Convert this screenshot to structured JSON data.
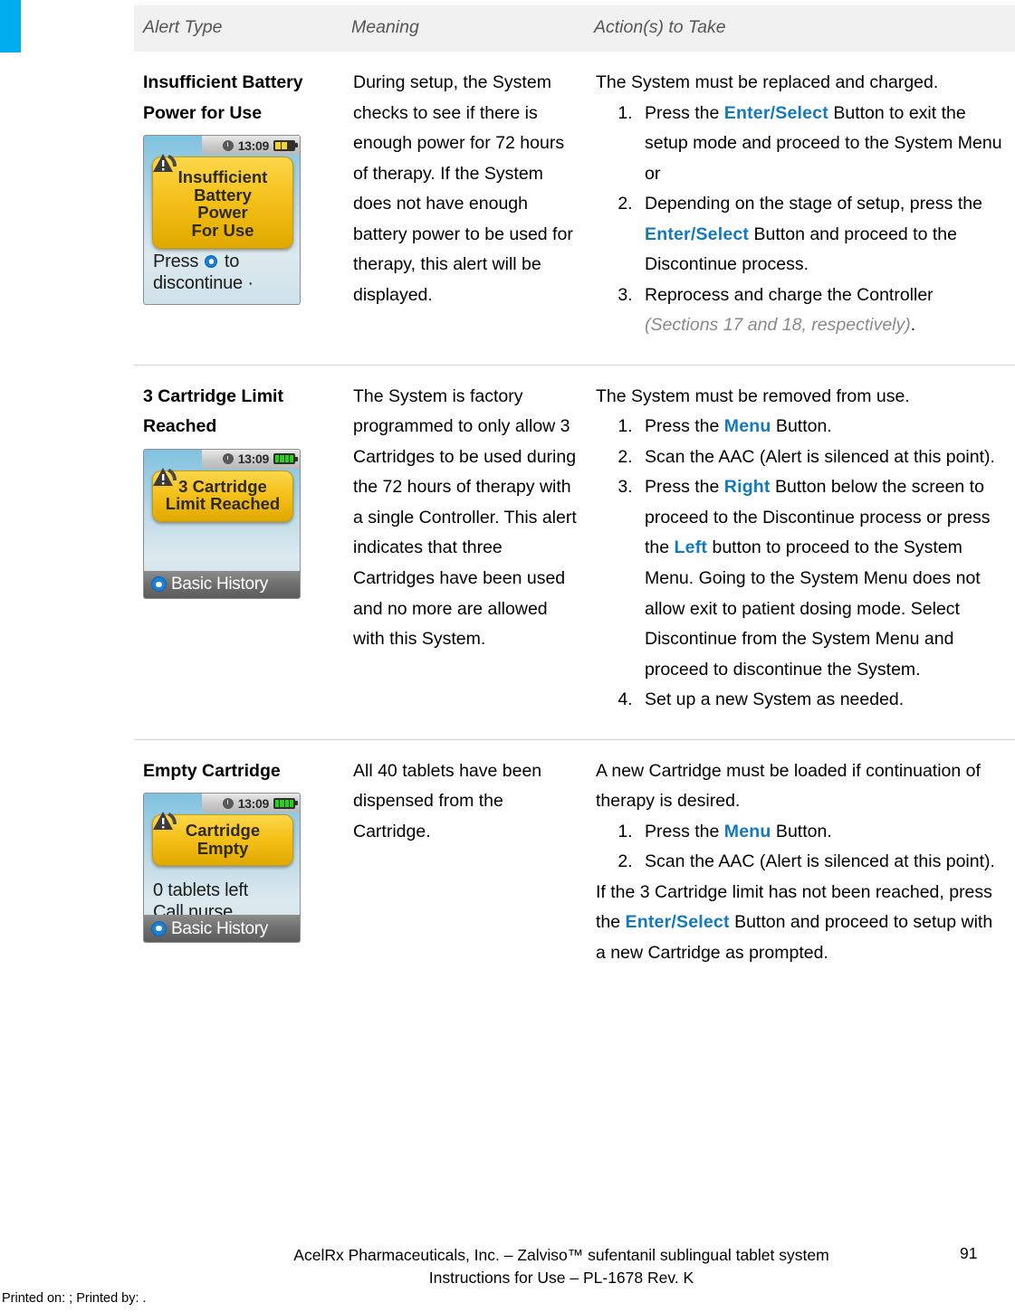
{
  "accent_color": "#00AEEF",
  "keyword_color": "#1279BF",
  "table": {
    "headers": {
      "alert_type": "Alert Type",
      "meaning": "Meaning",
      "action": "Action(s) to Take"
    },
    "rows": [
      {
        "type_line1": "Insufficient Battery",
        "type_line2": "Power for Use",
        "meaning": "During setup, the System checks to see if there is enough power for 72 hours of therapy.  If the System does not have enough battery power to be used for therapy, this alert will be displayed.",
        "action_intro": "The System must be replaced and charged.",
        "steps": [
          {
            "pre": "Press the ",
            "kw": "Enter/Select",
            "post": " Button to exit the setup mode and proceed to the System Menu or"
          },
          {
            "pre": "Depending on the stage of setup, press the ",
            "kw": "Enter/Select",
            "post": " Button and proceed to the Discontinue process."
          },
          {
            "pre": "Reprocess and charge the Controller ",
            "italic_gray": "(Sections 17 and 18, respectively)",
            "post": "."
          }
        ],
        "device": {
          "clock": "13:09",
          "battery": "low",
          "alert_lines": [
            "Insufficient",
            "Battery",
            "Power",
            "For Use"
          ],
          "message_line1_pre": "Press ",
          "message_line1_post": " to",
          "message_line2": "discontinue ·",
          "soft_key": null
        }
      },
      {
        "type_line1": "3 Cartridge Limit",
        "type_line2": "Reached",
        "meaning": "The System is factory programmed to only allow 3 Cartridges to be used during the 72 hours of therapy with a single Controller.  This alert indicates that three Cartridges have been used and no more are allowed with this System.",
        "action_intro": "The System must be removed from use.",
        "steps": [
          {
            "pre": "Press the ",
            "kw": "Menu",
            "post": " Button."
          },
          {
            "pre": "Scan the AAC (Alert is silenced at this point).",
            "kw": "",
            "post": ""
          },
          {
            "pre": "Press the ",
            "kw": "Right",
            "post": " Button below the screen to proceed to the Discontinue process or press the ",
            "kw2": "Left",
            "post2": " button to proceed to the System Menu.  Going to the System Menu does not allow exit to patient dosing mode. Select Discontinue from the System Menu and proceed to discontinue the System."
          },
          {
            "pre": "Set up a new System as needed.",
            "kw": "",
            "post": ""
          }
        ],
        "device": {
          "clock": "13:09",
          "battery": "full",
          "alert_lines": [
            "3 Cartridge",
            "Limit Reached"
          ],
          "message_line1_pre": "",
          "message_line1_post": "",
          "message_line2": "",
          "soft_key": "Basic History"
        }
      },
      {
        "type_line1": "Empty Cartridge",
        "type_line2": "",
        "meaning": "All 40 tablets have been dispensed from the Cartridge.",
        "action_intro": "A new Cartridge must be loaded if continuation of therapy is desired.",
        "steps": [
          {
            "pre": "Press the ",
            "kw": "Menu",
            "post": " Button."
          },
          {
            "pre": "Scan the AAC (Alert is silenced at this point).",
            "kw": "",
            "post": ""
          }
        ],
        "action_after_pre": "If the 3 Cartridge limit has not been reached, press the ",
        "action_after_kw": "Enter/Select",
        "action_after_post": " Button and proceed to setup with a new Cartridge as prompted.",
        "device": {
          "clock": "13:09",
          "battery": "full",
          "alert_lines": [
            "Cartridge",
            "Empty"
          ],
          "message_line1_pre": "0 tablets left",
          "message_line1_post": "",
          "message_line2": "Call nurse",
          "soft_key": "Basic History"
        }
      }
    ]
  },
  "footer": {
    "line1": "AcelRx Pharmaceuticals, Inc. – Zalviso™ sufentanil sublingual tablet system",
    "line2": "Instructions for Use – PL-1678 Rev. K",
    "page_number": "91",
    "print_line": "Printed on: ; Printed by: ."
  }
}
